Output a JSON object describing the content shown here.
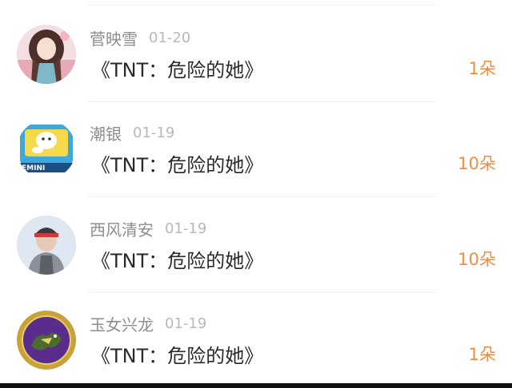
{
  "rows": [
    {
      "name": "菅映雪",
      "date": "01-20",
      "title": "《TNT：危险的她》",
      "count": "1朵"
    },
    {
      "name": "潮银",
      "date": "01-19",
      "title": "《TNT：危险的她》",
      "count": "10朵",
      "avatar_text": "EMINI"
    },
    {
      "name": "西风清安",
      "date": "01-19",
      "title": "《TNT：危险的她》",
      "count": "10朵"
    },
    {
      "name": "玉女兴龙",
      "date": "01-19",
      "title": "《TNT：危险的她》",
      "count": "1朵"
    }
  ],
  "colors": {
    "accent": "#ee8e3a",
    "name": "#8e8e8e",
    "date": "#b8b8b8"
  }
}
